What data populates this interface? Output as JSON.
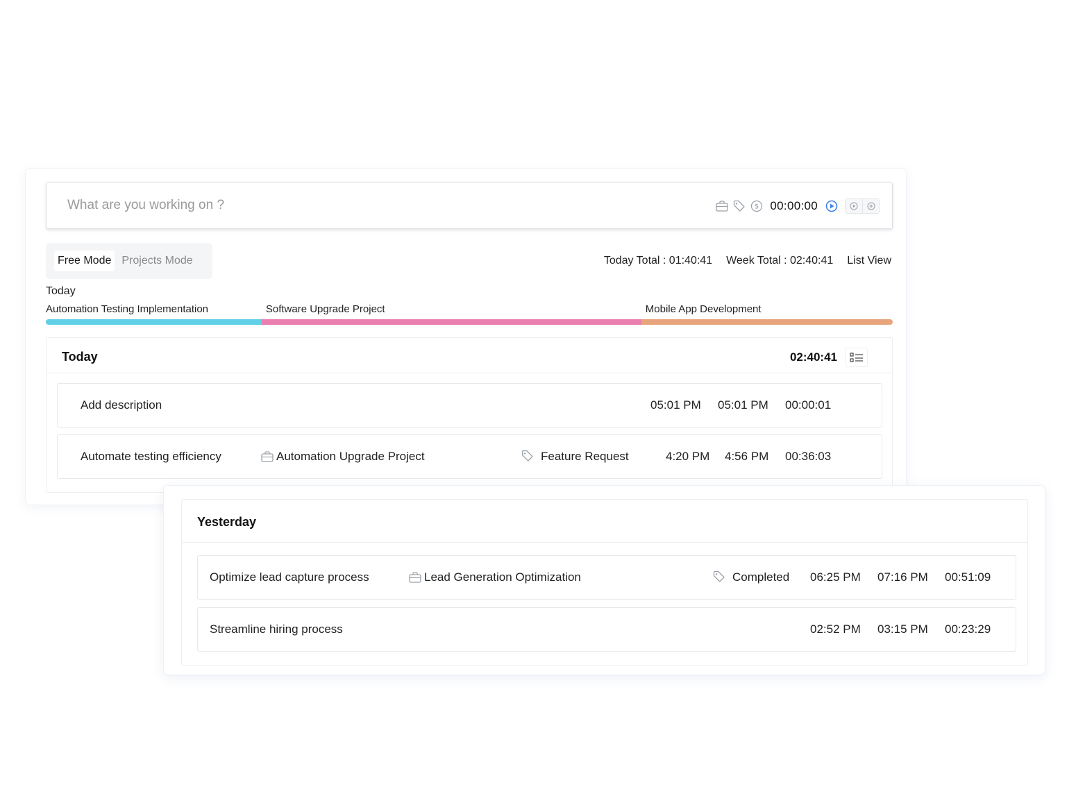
{
  "timer": {
    "placeholder": "What are you working on ?",
    "clock": "00:00:00",
    "icons": [
      "briefcase-icon",
      "tag-icon",
      "dollar-icon",
      "play-circle-icon",
      "play-small-icon",
      "plus-circle-icon"
    ],
    "accent_color": "#3b82e6"
  },
  "modes": {
    "free": "Free Mode",
    "projects": "Projects Mode",
    "active": "free"
  },
  "totals": {
    "today": "Today Total : 01:40:41",
    "week": "Week Total : 02:40:41",
    "view": "List View"
  },
  "timeline": {
    "label": "Today",
    "projects": [
      {
        "name": "Automation Testing Implementation",
        "color": "#5fd0e6",
        "fraction": 0.2548
      },
      {
        "name": "Software Upgrade Project",
        "color": "#ea7fb0",
        "fraction": 0.4483
      },
      {
        "name": "Mobile App Development",
        "color": "#e8a57d",
        "fraction": 0.2969
      }
    ]
  },
  "today": {
    "title": "Today",
    "total": "02:40:41",
    "entries": [
      {
        "description": "Add description",
        "project": "",
        "tag": "",
        "start": "05:01 PM",
        "end": "05:01 PM",
        "duration": "00:00:01"
      },
      {
        "description": "Automate testing efficiency",
        "project": "Automation Upgrade Project",
        "tag": "Feature Request",
        "start": "4:20 PM",
        "end": "4:56 PM",
        "duration": "00:36:03"
      }
    ]
  },
  "yesterday": {
    "title": "Yesterday",
    "entries": [
      {
        "description": "Optimize lead capture process",
        "project": "Lead Generation Optimization",
        "tag": "Completed",
        "start": "06:25 PM",
        "end": "07:16 PM",
        "duration": "00:51:09"
      },
      {
        "description": "Streamline hiring process",
        "project": "",
        "tag": "",
        "start": "02:52 PM",
        "end": "03:15 PM",
        "duration": "00:23:29"
      }
    ]
  }
}
